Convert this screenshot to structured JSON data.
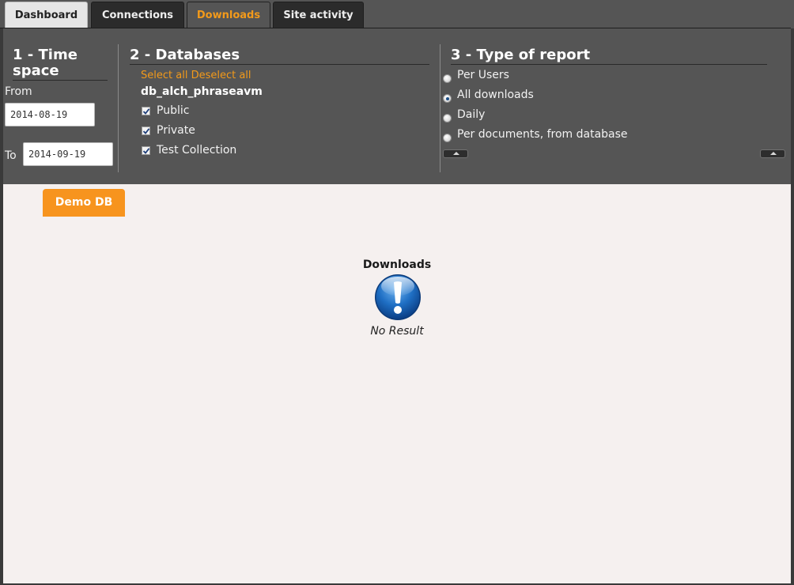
{
  "tabs": [
    {
      "label": "Dashboard"
    },
    {
      "label": "Connections"
    },
    {
      "label": "Downloads"
    },
    {
      "label": "Site activity"
    }
  ],
  "active_tab": "Downloads",
  "timespace": {
    "title_line1": "1 - Time",
    "title_line2": "space",
    "from_label": "From",
    "from_value": "2014-08-19",
    "to_label": "To",
    "to_value": "2014-09-19"
  },
  "databases": {
    "title": "2 - Databases",
    "select_all": "Select all",
    "deselect_all": "Deselect all",
    "db_name": "db_alch_phraseavm",
    "collections": [
      {
        "label": "Public",
        "checked": true
      },
      {
        "label": "Private",
        "checked": true
      },
      {
        "label": "Test Collection",
        "checked": true
      }
    ]
  },
  "report_type": {
    "title": "3 - Type of report",
    "options": [
      {
        "label": "Per Users",
        "selected": false
      },
      {
        "label": "All downloads",
        "selected": true
      },
      {
        "label": "Daily",
        "selected": false
      },
      {
        "label": "Per documents, from database",
        "selected": false
      }
    ]
  },
  "content": {
    "db_tab": "Demo DB",
    "result_title": "Downloads",
    "icon": "exclamation-icon",
    "no_result": "No Result"
  },
  "colors": {
    "accent": "#f7941e",
    "panel_bg": "#555555",
    "content_bg": "#f5f0ef"
  }
}
